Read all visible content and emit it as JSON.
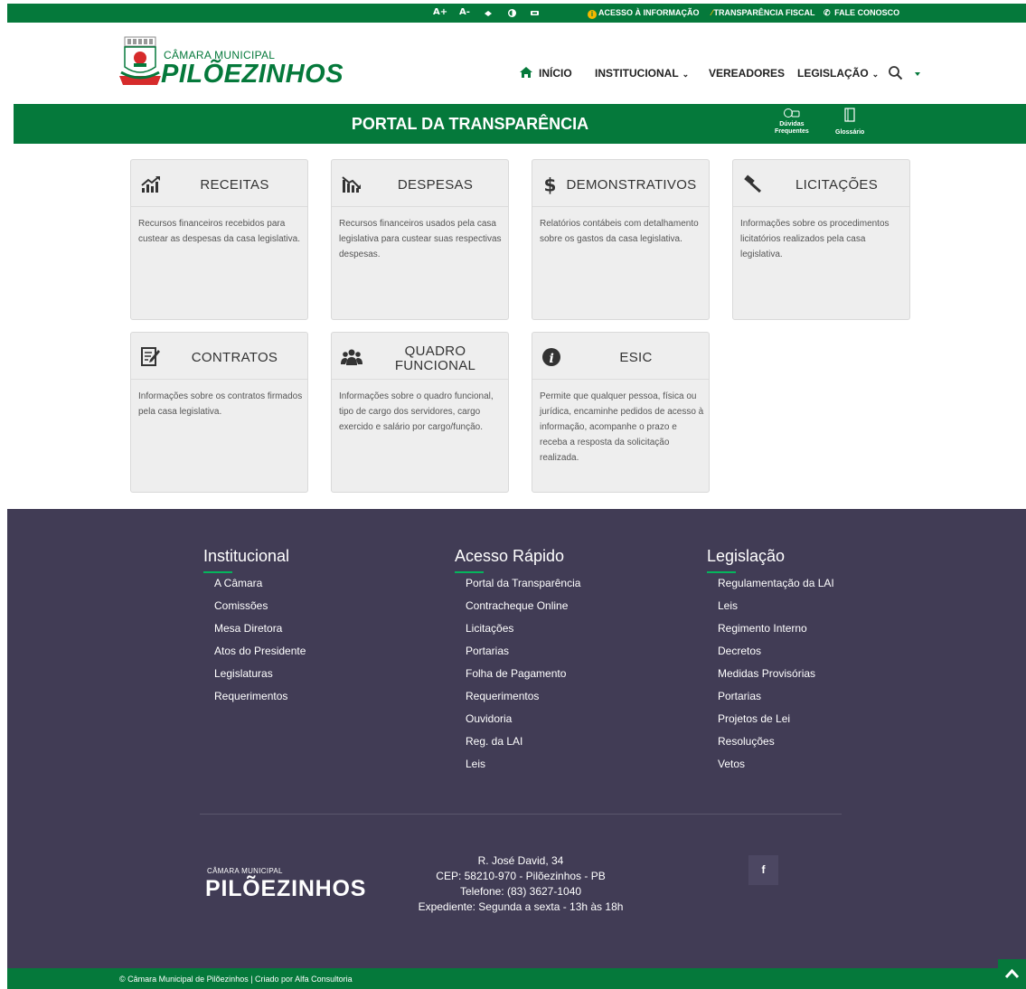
{
  "topbar": {
    "font_increase": "A+",
    "font_decrease": "A-",
    "links": {
      "access_info": "ACESSO À INFORMAÇÃO",
      "fiscal": "TRANSPARÊNCIA FISCAL",
      "contact": "FALE CONOSCO"
    },
    "icons": [
      "font-increase-icon",
      "font-decrease-icon",
      "accessibility-icon",
      "contrast-icon",
      "sign-language-icon",
      "info-icon",
      "money-icon",
      "phone-icon"
    ]
  },
  "header": {
    "logo_subtitle": "CÂMARA MUNICIPAL",
    "logo_title": "PILÕEZINHOS",
    "nav": {
      "home": "INÍCIO",
      "institutional": "INSTITUCIONAL",
      "councilors": "VEREADORES",
      "legislation": "LEGISLAÇÃO"
    }
  },
  "banner": {
    "title": "PORTAL DA TRANSPARÊNCIA",
    "faq_line1": "Dúvidas",
    "faq_line2": "Frequentes",
    "glossary": "Glossário"
  },
  "cards": [
    {
      "title": "RECEITAS",
      "icon": "chart-up-icon",
      "desc": "Recursos financeiros recebidos para custear as despesas da casa legislativa."
    },
    {
      "title": "DESPESAS",
      "icon": "chart-down-icon",
      "desc": "Recursos financeiros usados pela casa legislativa para custear suas respectivas despesas."
    },
    {
      "title": "DEMONSTRATIVOS",
      "icon": "dollar-icon",
      "desc": "Relatórios contábeis com detalhamento sobre os gastos da casa legislativa."
    },
    {
      "title": "LICITAÇÕES",
      "icon": "gavel-icon",
      "desc": "Informações sobre os procedimentos licitatórios realizados pela casa legislativa."
    },
    {
      "title": "CONTRATOS",
      "icon": "contract-icon",
      "desc": "Informações sobre os contratos firmados pela casa legislativa."
    },
    {
      "title_line1": "QUADRO",
      "title_line2": "FUNCIONAL",
      "icon": "users-icon",
      "desc": "Informações sobre o quadro funcional, tipo de cargo dos servidores, cargo exercido e salário por cargo/função."
    },
    {
      "title": "ESIC",
      "icon": "info-circle-icon",
      "desc": "Permite que qualquer pessoa, física ou jurídica, encaminhe pedidos de acesso à informação, acompanhe o prazo e receba a resposta da solicitação realizada."
    }
  ],
  "footer": {
    "institutional": {
      "title": "Institucional",
      "items": [
        "A Câmara",
        "Comissões",
        "Mesa Diretora",
        "Atos do Presidente",
        "Legislaturas",
        "Requerimentos"
      ]
    },
    "quick_access": {
      "title": "Acesso Rápido",
      "items": [
        "Portal da Transparência",
        "Contracheque Online",
        "Licitações",
        "Portarias",
        "Folha de Pagamento",
        "Requerimentos",
        "Ouvidoria",
        "Reg. da LAI",
        "Leis"
      ]
    },
    "legislation": {
      "title": "Legislação",
      "items": [
        "Regulamentação da LAI",
        "Leis",
        "Regimento Interno",
        "Decretos",
        "Medidas Provisórias",
        "Portarias",
        "Projetos de Lei",
        "Resoluções",
        "Vetos"
      ]
    },
    "logo_subtitle": "CÂMARA MUNICIPAL",
    "logo_title": "PILÕEZINHOS",
    "address": {
      "street": "R. José David, 34",
      "cep": "CEP: 58210-970 - Pilõezinhos - PB",
      "phone": "Telefone: (83) 3627-1040",
      "hours": "Expediente: Segunda a sexta - 13h às 18h"
    },
    "facebook": "f",
    "copyright": "© Câmara Municipal de Pilõezinhos | Criado por Alfa Consultoria"
  },
  "colors": {
    "brand_green": "#05793b",
    "footer_bg": "#413c55",
    "card_bg": "#eeeeee",
    "accent_line": "#05b55c"
  }
}
